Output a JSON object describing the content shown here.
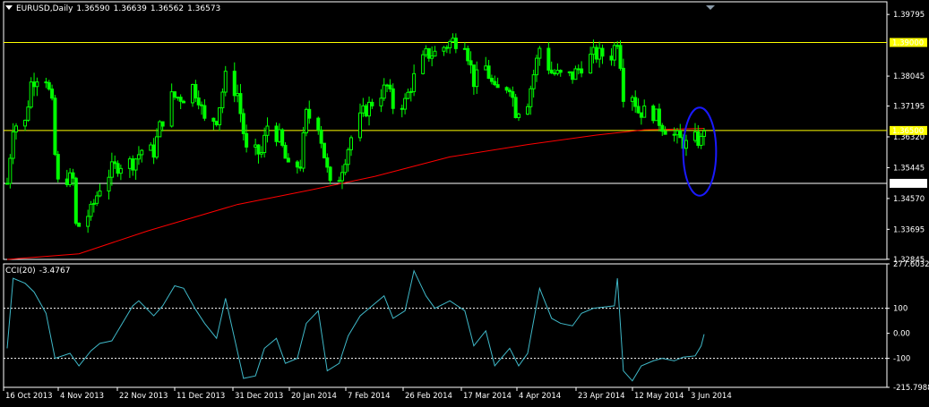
{
  "header": {
    "symbol": "EURUSD,Daily",
    "ohlc": [
      "1.36590",
      "1.36639",
      "1.36562",
      "1.36573"
    ]
  },
  "indicator_header": {
    "name": "CCI(20)",
    "value": "-3.4767"
  },
  "colors": {
    "background": "#000000",
    "candle": "#00ff00",
    "ma": "#ff0000",
    "cci": "#3fb8c8",
    "hline_yellow": "#ffff00",
    "hline_white": "#ffffff",
    "ellipse": "#1a1aff",
    "frame": "#ffffff"
  },
  "chart_data": [
    {
      "type": "candlestick",
      "name": "EURUSD,Daily",
      "ylim": [
        1.3284,
        1.3985
      ],
      "price_ticks": [
        "1.39795",
        "1.38045",
        "1.37195",
        "1.36320",
        "1.35445",
        "1.34570",
        "1.33695",
        "1.32845"
      ],
      "horizontal_levels": [
        {
          "value": 1.39,
          "label": "1.39000",
          "color": "#ffff00"
        },
        {
          "value": 1.365,
          "label": "1.36500",
          "color": "#ffff00"
        },
        {
          "value": 1.35,
          "label": "1.35000",
          "color": "#ffffff"
        }
      ],
      "x_labels": [
        "16 Oct 2013",
        "4 Nov 2013",
        "22 Nov 2013",
        "11 Dec 2013",
        "31 Dec 2013",
        "20 Jan 2014",
        "7 Feb 2014",
        "26 Feb 2014",
        "17 Mar 2014",
        "4 Apr 2014",
        "23 Apr 2014",
        "12 May 2014",
        "3 Jun 2014"
      ],
      "close_path": [
        {
          "date": "2013-10-15",
          "close": 1.35
        },
        {
          "date": "2013-10-17",
          "close": 1.3665
        },
        {
          "date": "2013-10-21",
          "close": 1.3672
        },
        {
          "date": "2013-10-23",
          "close": 1.3785
        },
        {
          "date": "2013-10-25",
          "close": 1.3805
        },
        {
          "date": "2013-10-28",
          "close": 1.38
        },
        {
          "date": "2013-10-30",
          "close": 1.372
        },
        {
          "date": "2013-10-31",
          "close": 1.358
        },
        {
          "date": "2013-11-01",
          "close": 1.35
        },
        {
          "date": "2013-11-04",
          "close": 1.3515
        },
        {
          "date": "2013-11-06",
          "close": 1.351
        },
        {
          "date": "2013-11-07",
          "close": 1.338
        },
        {
          "date": "2013-11-08",
          "close": 1.338
        },
        {
          "date": "2013-11-12",
          "close": 1.342
        },
        {
          "date": "2013-11-15",
          "close": 1.349
        },
        {
          "date": "2013-11-19",
          "close": 1.354
        },
        {
          "date": "2013-11-22",
          "close": 1.3555
        },
        {
          "date": "2013-11-26",
          "close": 1.356
        },
        {
          "date": "2013-11-29",
          "close": 1.3595
        },
        {
          "date": "2013-12-03",
          "close": 1.359
        },
        {
          "date": "2013-12-05",
          "close": 1.366
        },
        {
          "date": "2013-12-09",
          "close": 1.3745
        },
        {
          "date": "2013-12-13",
          "close": 1.3745
        },
        {
          "date": "2013-12-16",
          "close": 1.3775
        },
        {
          "date": "2013-12-18",
          "close": 1.3745
        },
        {
          "date": "2013-12-20",
          "close": 1.3675
        },
        {
          "date": "2013-12-24",
          "close": 1.3685
        },
        {
          "date": "2013-12-27",
          "close": 1.38
        },
        {
          "date": "2013-12-31",
          "close": 1.3755
        },
        {
          "date": "2014-01-03",
          "close": 1.359
        },
        {
          "date": "2014-01-08",
          "close": 1.3585
        },
        {
          "date": "2014-01-10",
          "close": 1.3665
        },
        {
          "date": "2014-01-14",
          "close": 1.363
        },
        {
          "date": "2014-01-17",
          "close": 1.354
        },
        {
          "date": "2014-01-21",
          "close": 1.3555
        },
        {
          "date": "2014-01-23",
          "close": 1.3695
        },
        {
          "date": "2014-01-27",
          "close": 1.367
        },
        {
          "date": "2014-01-31",
          "close": 1.349
        },
        {
          "date": "2014-02-03",
          "close": 1.352
        },
        {
          "date": "2014-02-07",
          "close": 1.363
        },
        {
          "date": "2014-02-11",
          "close": 1.37
        },
        {
          "date": "2014-02-14",
          "close": 1.373
        },
        {
          "date": "2014-02-19",
          "close": 1.3775
        },
        {
          "date": "2014-02-21",
          "close": 1.372
        },
        {
          "date": "2014-02-25",
          "close": 1.373
        },
        {
          "date": "2014-02-28",
          "close": 1.38
        },
        {
          "date": "2014-03-04",
          "close": 1.3865
        },
        {
          "date": "2014-03-07",
          "close": 1.387
        },
        {
          "date": "2014-03-13",
          "close": 1.3905
        },
        {
          "date": "2014-03-17",
          "close": 1.3905
        },
        {
          "date": "2014-03-20",
          "close": 1.379
        },
        {
          "date": "2014-03-24",
          "close": 1.383
        },
        {
          "date": "2014-03-27",
          "close": 1.376
        },
        {
          "date": "2014-04-01",
          "close": 1.378
        },
        {
          "date": "2014-04-03",
          "close": 1.3705
        },
        {
          "date": "2014-04-07",
          "close": 1.3735
        },
        {
          "date": "2014-04-11",
          "close": 1.3885
        },
        {
          "date": "2014-04-15",
          "close": 1.3815
        },
        {
          "date": "2014-04-18",
          "close": 1.3805
        },
        {
          "date": "2014-04-22",
          "close": 1.3805
        },
        {
          "date": "2014-04-25",
          "close": 1.3835
        },
        {
          "date": "2014-04-29",
          "close": 1.3865
        },
        {
          "date": "2014-05-05",
          "close": 1.3865
        },
        {
          "date": "2014-05-07",
          "close": 1.391
        },
        {
          "date": "2014-05-08",
          "close": 1.3845
        },
        {
          "date": "2014-05-09",
          "close": 1.3755
        },
        {
          "date": "2014-05-12",
          "close": 1.3755
        },
        {
          "date": "2014-05-14",
          "close": 1.3705
        },
        {
          "date": "2014-05-19",
          "close": 1.37
        },
        {
          "date": "2014-05-22",
          "close": 1.3665
        },
        {
          "date": "2014-05-26",
          "close": 1.3635
        },
        {
          "date": "2014-05-30",
          "close": 1.361
        },
        {
          "date": "2014-06-02",
          "close": 1.3625
        },
        {
          "date": "2014-06-04",
          "close": 1.362
        },
        {
          "date": "2014-06-05",
          "close": 1.366
        }
      ],
      "moving_average": [
        {
          "date": "2013-10-15",
          "value": 1.3284
        },
        {
          "date": "2013-11-08",
          "value": 1.33
        },
        {
          "date": "2013-12-01",
          "value": 1.3365
        },
        {
          "date": "2013-12-31",
          "value": 1.344
        },
        {
          "date": "2014-01-25",
          "value": 1.3482
        },
        {
          "date": "2014-02-15",
          "value": 1.352
        },
        {
          "date": "2014-03-12",
          "value": 1.3575
        },
        {
          "date": "2014-04-07",
          "value": 1.361
        },
        {
          "date": "2014-04-30",
          "value": 1.3637
        },
        {
          "date": "2014-05-16",
          "value": 1.3652
        },
        {
          "date": "2014-06-05",
          "value": 1.3656
        }
      ],
      "annotation": {
        "shape": "ellipse",
        "around": "2014-06-02 to 2014-06-05",
        "ylim": [
          1.3465,
          1.3715
        ]
      }
    },
    {
      "type": "line",
      "name": "CCI(20)",
      "ylim": [
        -215.7988,
        277.6032
      ],
      "y_ticks": [
        "277.6032",
        "100",
        "0.00",
        "-100",
        "-215.7988"
      ],
      "reference_levels": [
        100,
        -100
      ],
      "values": [
        {
          "date": "2013-10-15",
          "value": -60
        },
        {
          "date": "2013-10-17",
          "value": 220
        },
        {
          "date": "2013-10-21",
          "value": 200
        },
        {
          "date": "2013-10-24",
          "value": 165
        },
        {
          "date": "2013-10-28",
          "value": 80
        },
        {
          "date": "2013-10-31",
          "value": -100
        },
        {
          "date": "2013-11-05",
          "value": -80
        },
        {
          "date": "2013-11-08",
          "value": -130
        },
        {
          "date": "2013-11-12",
          "value": -70
        },
        {
          "date": "2013-11-15",
          "value": -40
        },
        {
          "date": "2013-11-19",
          "value": -30
        },
        {
          "date": "2013-11-22",
          "value": 30
        },
        {
          "date": "2013-11-26",
          "value": 110
        },
        {
          "date": "2013-11-28",
          "value": 130
        },
        {
          "date": "2013-12-03",
          "value": 70
        },
        {
          "date": "2013-12-06",
          "value": 110
        },
        {
          "date": "2013-12-10",
          "value": 190
        },
        {
          "date": "2013-12-13",
          "value": 180
        },
        {
          "date": "2013-12-17",
          "value": 95
        },
        {
          "date": "2013-12-20",
          "value": 40
        },
        {
          "date": "2013-12-24",
          "value": -20
        },
        {
          "date": "2013-12-27",
          "value": 140
        },
        {
          "date": "2014-01-02",
          "value": -180
        },
        {
          "date": "2014-01-06",
          "value": -170
        },
        {
          "date": "2014-01-09",
          "value": -60
        },
        {
          "date": "2014-01-13",
          "value": -20
        },
        {
          "date": "2014-01-16",
          "value": -120
        },
        {
          "date": "2014-01-20",
          "value": -100
        },
        {
          "date": "2014-01-23",
          "value": 40
        },
        {
          "date": "2014-01-27",
          "value": 90
        },
        {
          "date": "2014-01-30",
          "value": -150
        },
        {
          "date": "2014-02-03",
          "value": -120
        },
        {
          "date": "2014-02-06",
          "value": -10
        },
        {
          "date": "2014-02-10",
          "value": 70
        },
        {
          "date": "2014-02-14",
          "value": 110
        },
        {
          "date": "2014-02-18",
          "value": 150
        },
        {
          "date": "2014-02-21",
          "value": 60
        },
        {
          "date": "2014-02-25",
          "value": 90
        },
        {
          "date": "2014-02-28",
          "value": 250
        },
        {
          "date": "2014-03-04",
          "value": 150
        },
        {
          "date": "2014-03-07",
          "value": 100
        },
        {
          "date": "2014-03-12",
          "value": 130
        },
        {
          "date": "2014-03-17",
          "value": 90
        },
        {
          "date": "2014-03-20",
          "value": -50
        },
        {
          "date": "2014-03-24",
          "value": 10
        },
        {
          "date": "2014-03-27",
          "value": -130
        },
        {
          "date": "2014-04-01",
          "value": -60
        },
        {
          "date": "2014-04-04",
          "value": -130
        },
        {
          "date": "2014-04-07",
          "value": -80
        },
        {
          "date": "2014-04-11",
          "value": 180
        },
        {
          "date": "2014-04-15",
          "value": 60
        },
        {
          "date": "2014-04-18",
          "value": 40
        },
        {
          "date": "2014-04-22",
          "value": 30
        },
        {
          "date": "2014-04-25",
          "value": 80
        },
        {
          "date": "2014-04-29",
          "value": 100
        },
        {
          "date": "2014-05-06",
          "value": 110
        },
        {
          "date": "2014-05-07",
          "value": 220
        },
        {
          "date": "2014-05-09",
          "value": -150
        },
        {
          "date": "2014-05-12",
          "value": -190
        },
        {
          "date": "2014-05-15",
          "value": -130
        },
        {
          "date": "2014-05-19",
          "value": -110
        },
        {
          "date": "2014-05-22",
          "value": -100
        },
        {
          "date": "2014-05-26",
          "value": -110
        },
        {
          "date": "2014-05-29",
          "value": -95
        },
        {
          "date": "2014-06-02",
          "value": -90
        },
        {
          "date": "2014-06-04",
          "value": -50
        },
        {
          "date": "2014-06-05",
          "value": -3.4767
        }
      ]
    }
  ]
}
